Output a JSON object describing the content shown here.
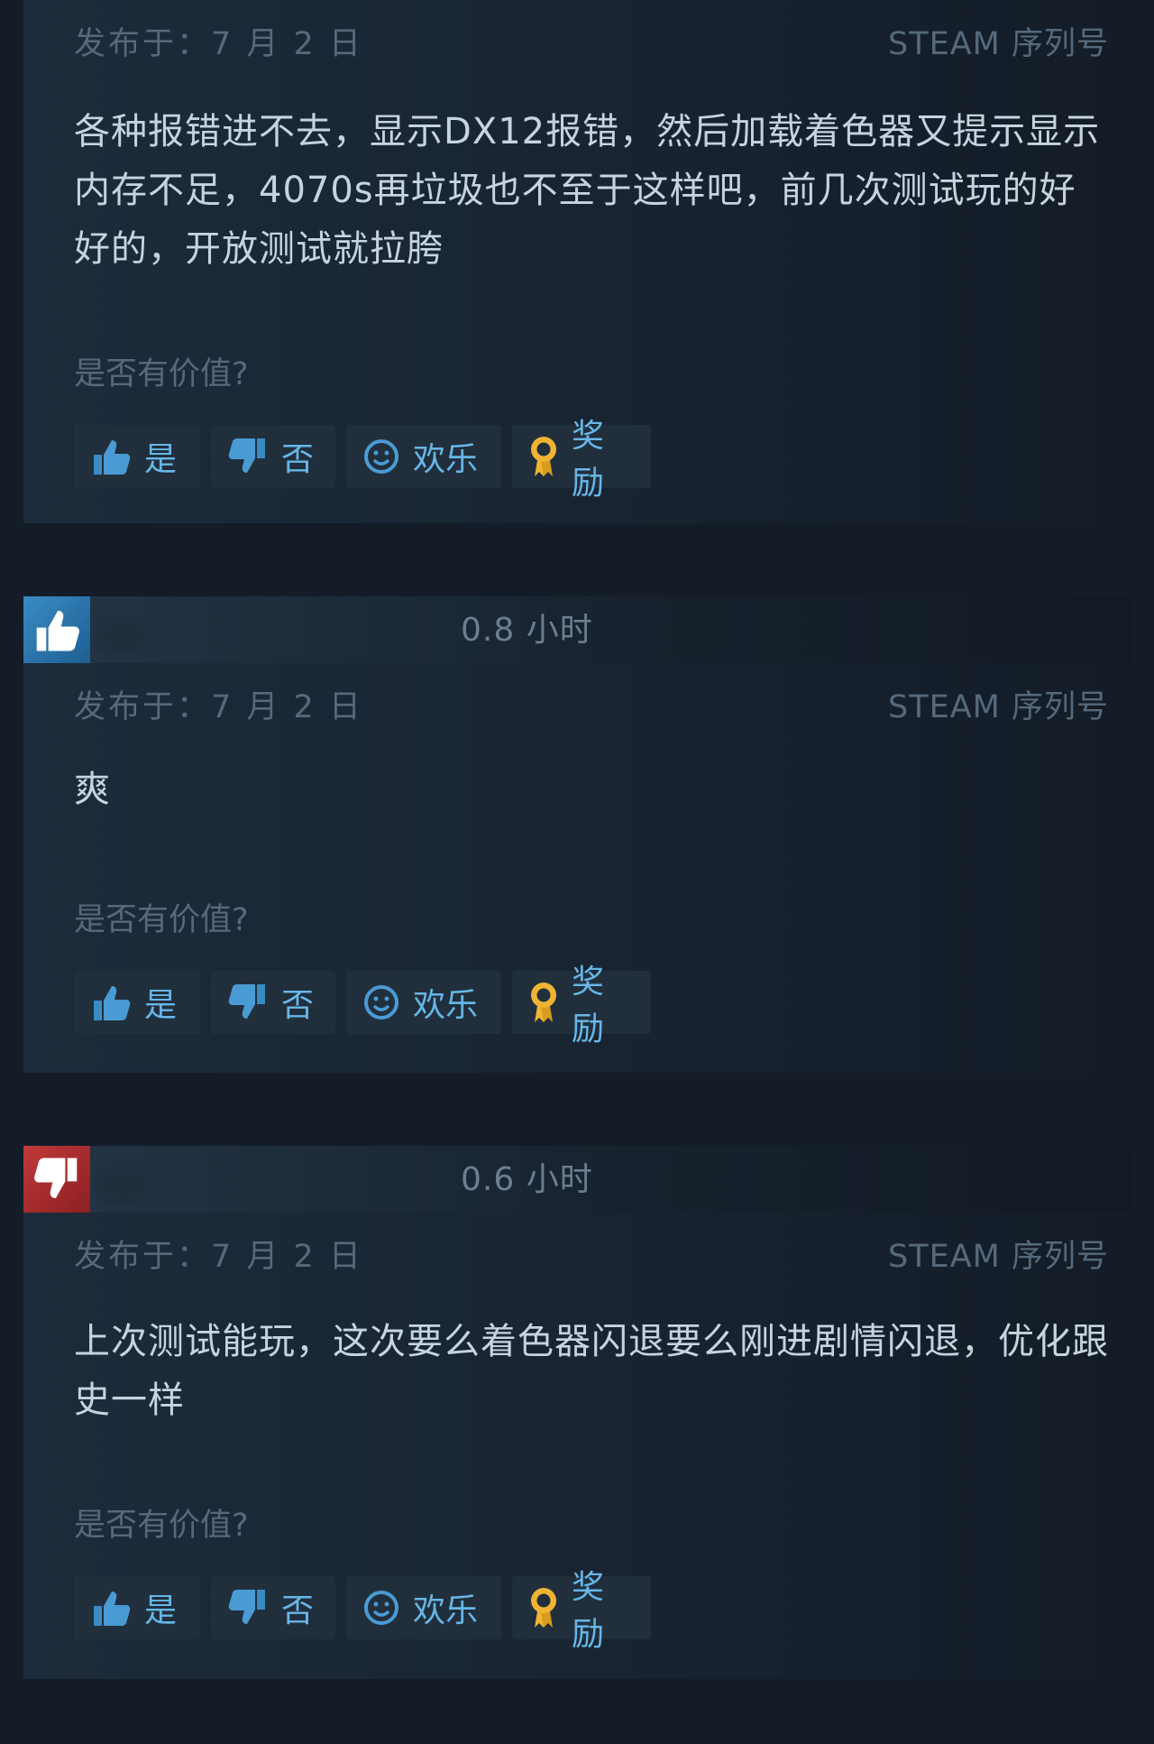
{
  "reviews": [
    {
      "posted": "发布于：7 月 2 日",
      "product_type": "STEAM 序列号",
      "text": "各种报错进不去，显示DX12报错，然后加载着色器又提示显示内存不足，4070s再垃圾也不至于这样吧，前几次测试玩的好好的，开放测试就拉胯",
      "helpful_question": "是否有价值?",
      "buttons": {
        "yes": "是",
        "no": "否",
        "funny": "欢乐",
        "award": "奖励"
      }
    },
    {
      "vote": "recommended",
      "hours": "0.8 小时",
      "posted": "发布于：7 月 2 日",
      "product_type": "STEAM 序列号",
      "text": "爽",
      "helpful_question": "是否有价值?",
      "buttons": {
        "yes": "是",
        "no": "否",
        "funny": "欢乐",
        "award": "奖励"
      }
    },
    {
      "vote": "not-recommended",
      "hours": "0.6 小时",
      "posted": "发布于：7 月 2 日",
      "product_type": "STEAM 序列号",
      "text": "上次测试能玩，这次要么着色器闪退要么刚进剧情闪退，优化跟史一样",
      "helpful_question": "是否有价值?",
      "buttons": {
        "yes": "是",
        "no": "否",
        "funny": "欢乐",
        "award": "奖励"
      }
    }
  ],
  "icons": {
    "thumbs_up": "thumbs-up-icon",
    "thumbs_down": "thumbs-down-icon",
    "funny": "smiley-icon",
    "award": "award-ribbon-icon"
  },
  "colors": {
    "page_bg": "#131c27",
    "card_bg": "#1c2b3b",
    "text": "#c6d4df",
    "muted": "#56697c",
    "link_blue": "#67b7e8",
    "award_gold": "#f0b432",
    "recommended": "#3a8bc4",
    "not_recommended": "#c0393a"
  }
}
